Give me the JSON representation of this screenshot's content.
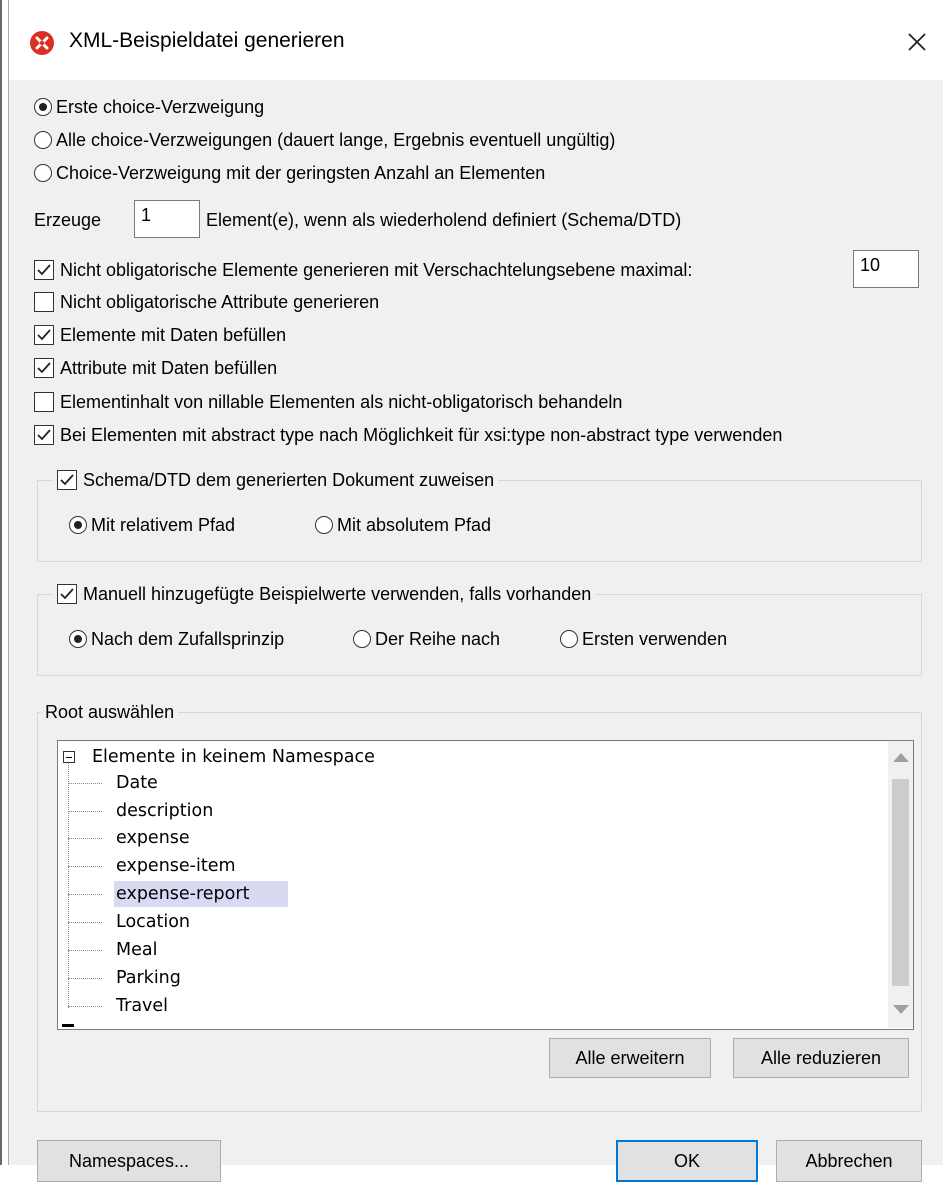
{
  "window": {
    "title": "XML-Beispieldatei generieren"
  },
  "choice": {
    "options": [
      "Erste choice-Verzweigung",
      "Alle choice-Verzweigungen (dauert lange, Ergebnis eventuell ungültig)",
      "Choice-Verzweigung mit der geringsten Anzahl an Elementen"
    ],
    "selected": "Erste choice-Verzweigung"
  },
  "repeat": {
    "prefix": "Erzeuge",
    "value": "1",
    "suffix": "Element(e), wenn als wiederholend definiert (Schema/DTD)"
  },
  "options": [
    {
      "label": "Nicht obligatorische Elemente generieren mit Verschachtelungsebene maximal:",
      "checked": true
    },
    {
      "label": "Nicht obligatorische Attribute generieren",
      "checked": false
    },
    {
      "label": "Elemente mit Daten befüllen",
      "checked": true
    },
    {
      "label": "Attribute mit Daten befüllen",
      "checked": true
    },
    {
      "label": "Elementinhalt von nillable Elementen als nicht-obligatorisch behandeln",
      "checked": false
    },
    {
      "label": "Bei Elementen mit abstract type nach Möglichkeit für xsi:type non-abstract type verwenden",
      "checked": true
    }
  ],
  "max_depth": "10",
  "schema_group": {
    "label": "Schema/DTD dem generierten Dokument zuweisen",
    "checked": true,
    "relative": "Mit relativem Pfad",
    "absolute": "Mit absolutem Pfad",
    "selected": "Mit relativem Pfad"
  },
  "sample_group": {
    "label": "Manuell hinzugefügte Beispielwerte verwenden, falls vorhanden",
    "checked": true,
    "random": "Nach dem Zufallsprinzip",
    "sequential": "Der Reihe nach",
    "first": "Ersten verwenden",
    "selected": "Nach dem Zufallsprinzip"
  },
  "root": {
    "label": "Root auswählen",
    "namespace": "Elemente in keinem Namespace",
    "items": [
      "Date",
      "description",
      "expense",
      "expense-item",
      "expense-report",
      "Location",
      "Meal",
      "Parking",
      "Travel"
    ],
    "selected": "expense-report",
    "expand_all": "Alle erweitern",
    "collapse_all": "Alle reduzieren"
  },
  "footer": {
    "namespaces": "Namespaces...",
    "ok": "OK",
    "cancel": "Abbrechen"
  },
  "colors": {
    "selection": "#d9d9f3",
    "default_button_border": "#0078d7",
    "icon_red": "#d93025"
  }
}
